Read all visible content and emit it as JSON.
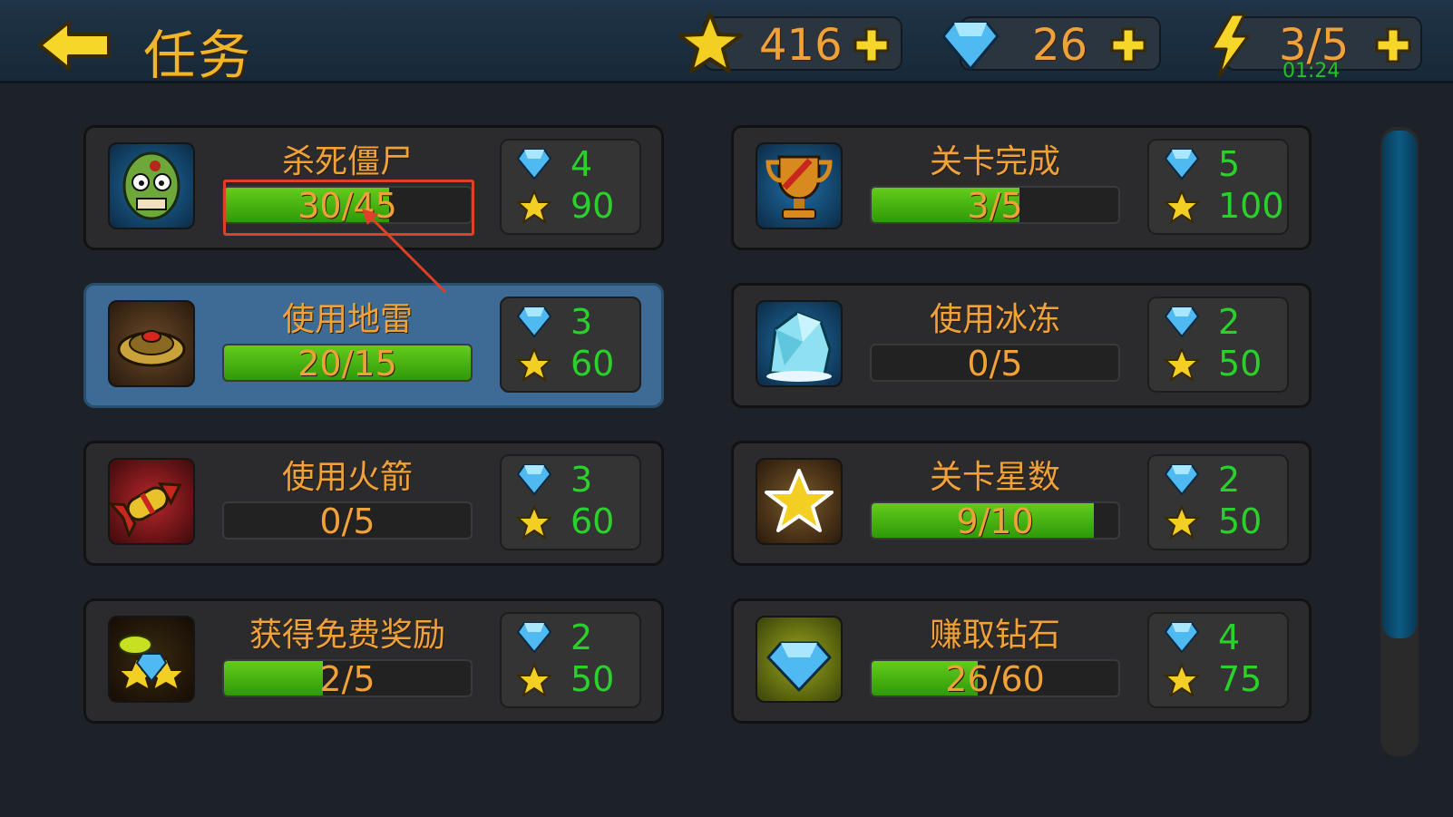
{
  "header": {
    "title": "任务",
    "stars": "416",
    "gems": "26",
    "energy": "3/5",
    "energy_timer": "01:24"
  },
  "tasks": [
    {
      "title": "杀死僵尸",
      "progress_text": "30/45",
      "progress": 0.67,
      "gems": "4",
      "stars": "90",
      "icon": "zombie-icon"
    },
    {
      "title": "关卡完成",
      "progress_text": "3/5",
      "progress": 0.6,
      "gems": "5",
      "stars": "100",
      "icon": "trophy-icon"
    },
    {
      "title": "使用地雷",
      "progress_text": "20/15",
      "progress": 1.0,
      "gems": "3",
      "stars": "60",
      "icon": "landmine-icon",
      "selected": true
    },
    {
      "title": "使用冰冻",
      "progress_text": "0/5",
      "progress": 0,
      "gems": "2",
      "stars": "50",
      "icon": "ice-icon"
    },
    {
      "title": "使用火箭",
      "progress_text": "0/5",
      "progress": 0,
      "gems": "3",
      "stars": "60",
      "icon": "rocket-icon"
    },
    {
      "title": "关卡星数",
      "progress_text": "9/10",
      "progress": 0.9,
      "gems": "2",
      "stars": "50",
      "icon": "star-icon"
    },
    {
      "title": "获得免费奖励",
      "progress_text": "2/5",
      "progress": 0.4,
      "gems": "2",
      "stars": "50",
      "icon": "free-reward-icon"
    },
    {
      "title": "赚取钻石",
      "progress_text": "26/60",
      "progress": 0.43,
      "gems": "4",
      "stars": "75",
      "icon": "diamond-icon"
    }
  ],
  "colors": {
    "accent": "#f0a23a",
    "reward_text": "#2bd12b",
    "annotation": "#e0402a"
  }
}
